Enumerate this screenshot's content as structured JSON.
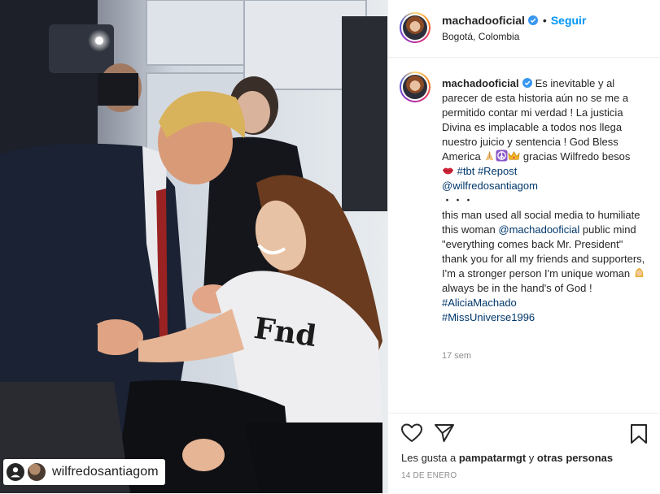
{
  "photo": {
    "repost_tag": "wilfredosantiagom",
    "shirt_text": "Fnd"
  },
  "header": {
    "username": "machadooficial",
    "dot": "•",
    "follow_label": "Seguir",
    "location": "Bogotá, Colombia"
  },
  "caption": {
    "username": "machadooficial",
    "text_1": "Es inevitable y al parecer de esta historia aún no se me a permitido contar mi verdad ! La justicia Divina es implacable a todos nos llega nuestro juicio y sentencia ! God Bless America ",
    "text_2": " gracias Wilfredo besos ",
    "hashtag_tbt": "#tbt",
    "hashtag_repost": "#Repost",
    "mention_wilfredo": "@wilfredosantiagom",
    "dots": "・・・",
    "text_3": "this man used all social media to humiliate this woman ",
    "mention_machado": "@machadooficial",
    "text_4": " public mind \"everything comes back Mr. President\" thank you for all my friends and supporters, I'm a stronger person I'm unique woman ",
    "text_5": " always be in the hand's of God ! ",
    "hashtag_alicia": "#AliciaMachado",
    "hashtag_missuniverse": "#MissUniverse1996",
    "emojis": [
      "folded-hands",
      "peace-symbol",
      "crown",
      "kiss-lips",
      "woman-blonde"
    ]
  },
  "timestamp": "17 sem",
  "likes": {
    "prefix": "Les gusta a ",
    "user": "pampatarmgt",
    "middle": " y ",
    "others": "otras personas"
  },
  "date": "14 DE ENERO",
  "colors": {
    "link": "#00376b",
    "follow": "#0095f6",
    "muted": "#8e8e8e",
    "verified": "#3897f0"
  }
}
